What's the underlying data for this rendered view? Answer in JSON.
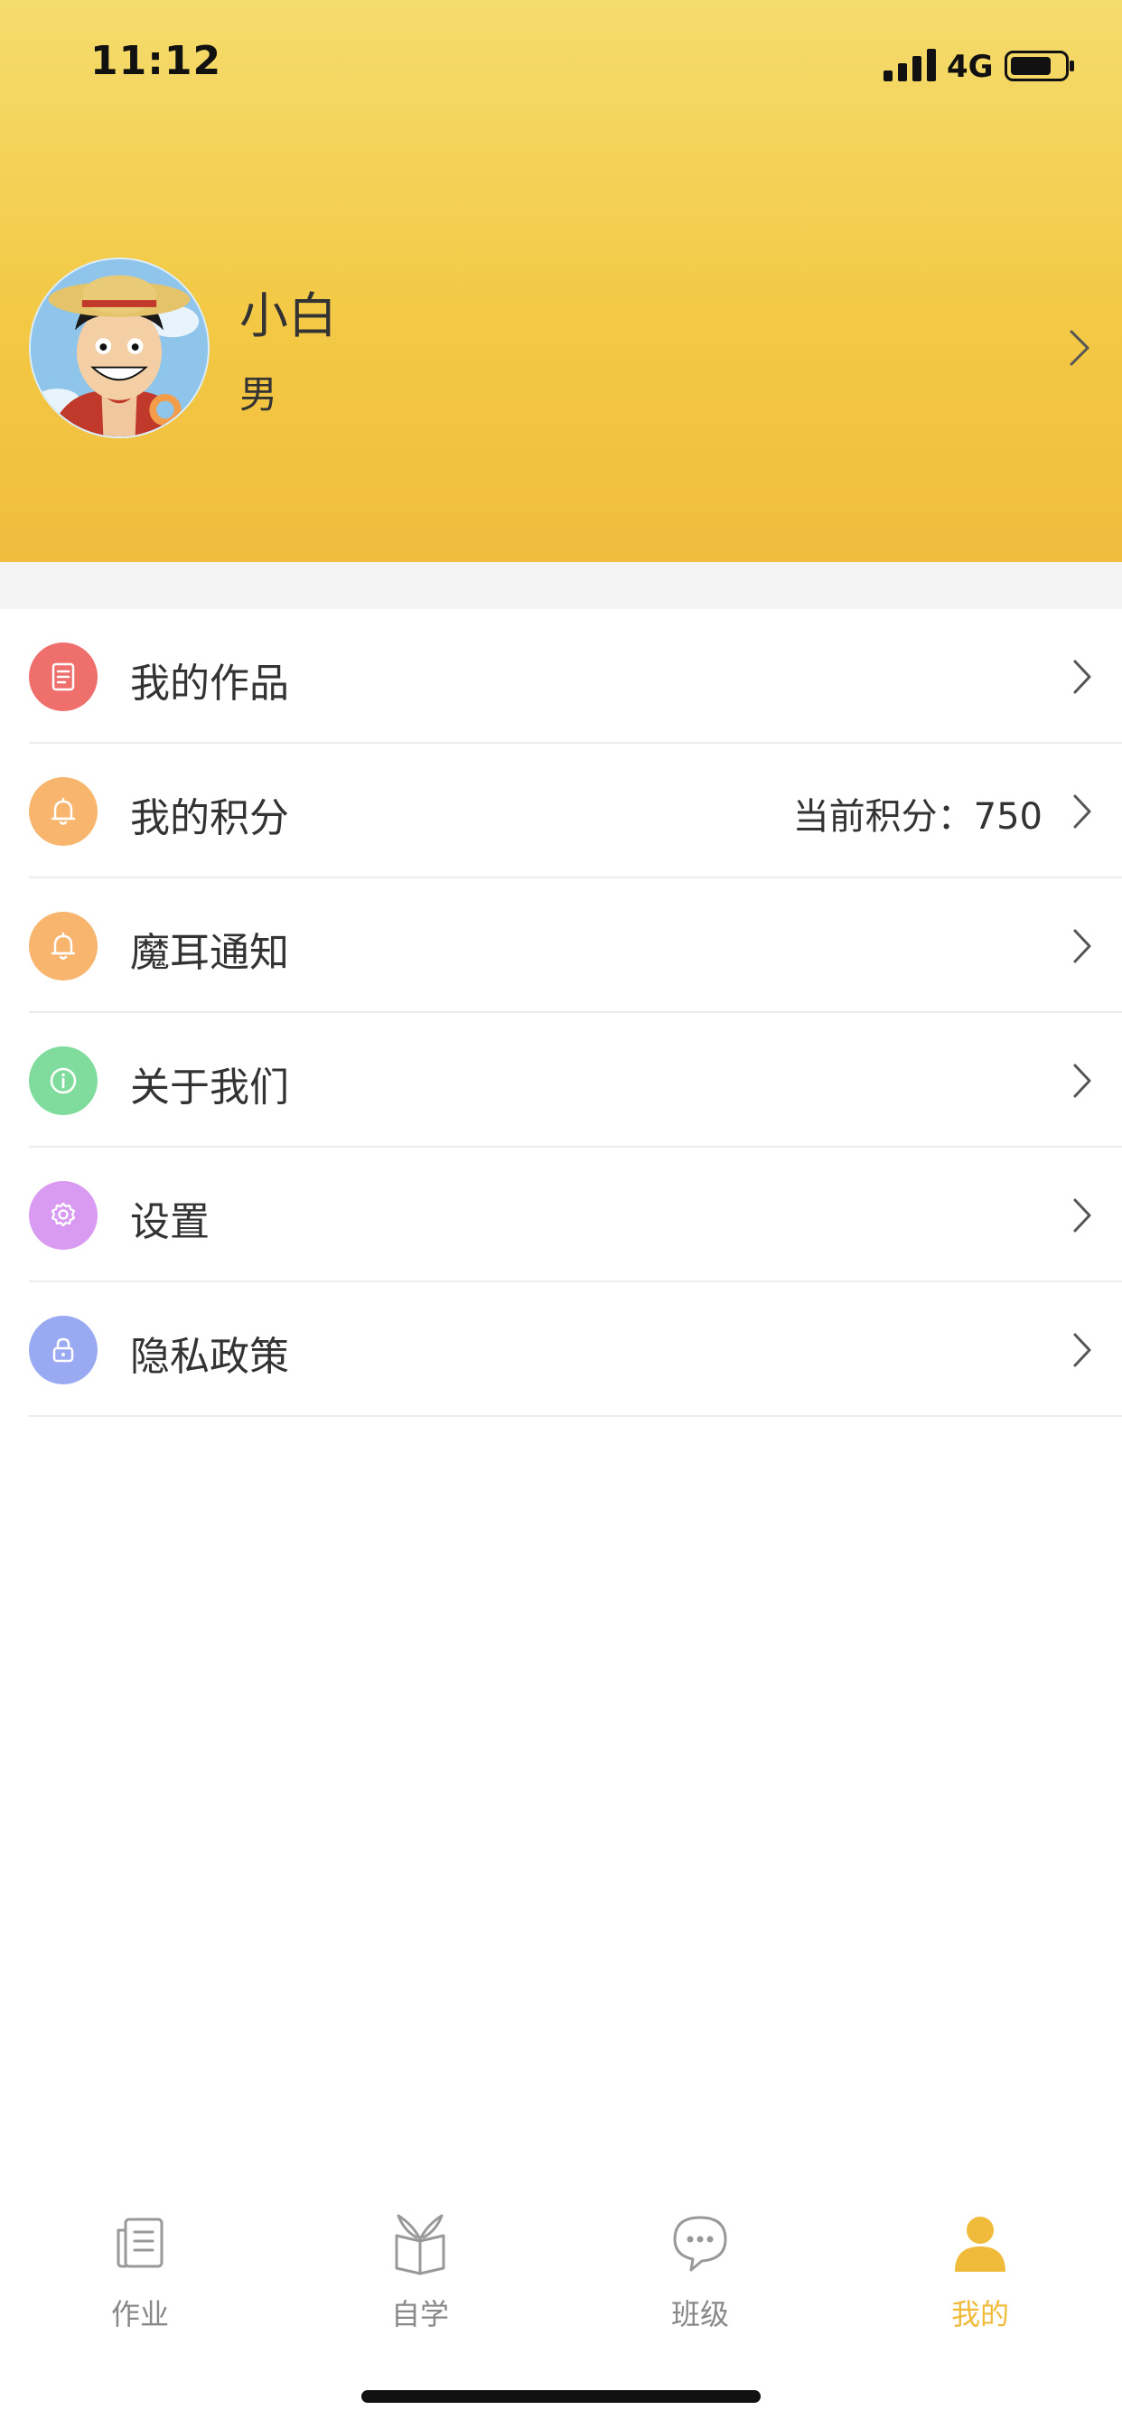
{
  "status_bar": {
    "time": "11:12",
    "network": "4G"
  },
  "profile": {
    "name": "小白",
    "gender": "男"
  },
  "menu": {
    "items": [
      {
        "label": "我的作品",
        "value": "",
        "icon": "document-icon",
        "color": "#ef6f6c"
      },
      {
        "label": "我的积分",
        "value": "当前积分：750",
        "icon": "bell-icon",
        "color": "#f7b56e"
      },
      {
        "label": "魔耳通知",
        "value": "",
        "icon": "bell-icon",
        "color": "#f7b56e"
      },
      {
        "label": "关于我们",
        "value": "",
        "icon": "info-icon",
        "color": "#7fdc9c"
      },
      {
        "label": "设置",
        "value": "",
        "icon": "gear-icon",
        "color": "#d99bf2"
      },
      {
        "label": "隐私政策",
        "value": "",
        "icon": "lock-icon",
        "color": "#9aaaf2"
      }
    ]
  },
  "tabbar": {
    "tabs": [
      {
        "label": "作业",
        "icon": "homework-icon",
        "active": false
      },
      {
        "label": "自学",
        "icon": "book-icon",
        "active": false
      },
      {
        "label": "班级",
        "icon": "chat-icon",
        "active": false
      },
      {
        "label": "我的",
        "icon": "person-icon",
        "active": true
      }
    ]
  },
  "colors": {
    "accent": "#f0bb3a",
    "header_top": "#f5dc6e",
    "header_bottom": "#f0bd3d",
    "inactive_tab": "#888888"
  }
}
